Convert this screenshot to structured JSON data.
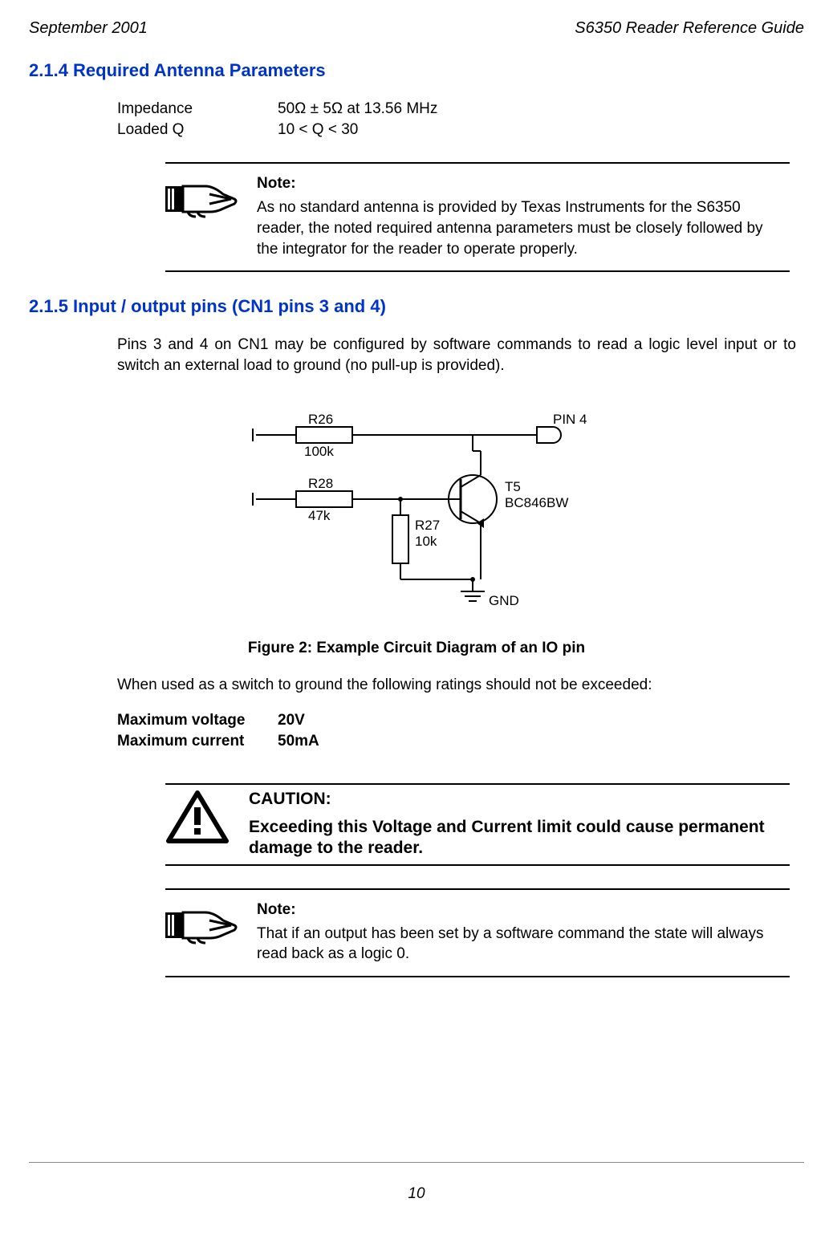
{
  "header": {
    "left": "September 2001",
    "right": "S6350 Reader Reference Guide"
  },
  "sections": {
    "s214": {
      "heading": "2.1.4  Required Antenna Parameters",
      "params": {
        "impedance_label": "Impedance",
        "impedance_value": "50Ω ± 5Ω at 13.56 MHz",
        "loadedq_label": "Loaded Q",
        "loadedq_value": "10 < Q < 30"
      },
      "note": {
        "title": "Note:",
        "text": "As no standard antenna is provided by Texas Instruments for the S6350 reader, the noted required antenna parameters must be closely followed by the integrator for the reader to operate properly."
      }
    },
    "s215": {
      "heading": "2.1.5  Input / output pins (CN1 pins 3 and 4)",
      "intro": "Pins 3 and 4 on CN1 may be configured by software commands to read a logic level input or to switch an external load to ground (no pull-up is provided).",
      "figure": {
        "caption": "Figure 2:  Example Circuit Diagram of an IO pin",
        "labels": {
          "r26": "R26",
          "r26_val": "100k",
          "r28": "R28",
          "r28_val": "47k",
          "r27": "R27",
          "r27_val": "10k",
          "t5": "T5",
          "t5_part": "BC846BW",
          "pin4": "PIN 4",
          "gnd": "GND"
        }
      },
      "switch_intro": "When used as a switch to ground the following ratings should not be exceeded:",
      "ratings": {
        "voltage_label": "Maximum voltage",
        "voltage_value": "20V",
        "current_label": "Maximum current",
        "current_value": "50mA"
      },
      "caution": {
        "title": "CAUTION:",
        "text": "Exceeding this Voltage and Current limit could cause permanent damage to the reader."
      },
      "note2": {
        "title": "Note:",
        "text": "That if an output has been set by a software command the state will always read back as a logic 0."
      }
    }
  },
  "page_number": "10"
}
